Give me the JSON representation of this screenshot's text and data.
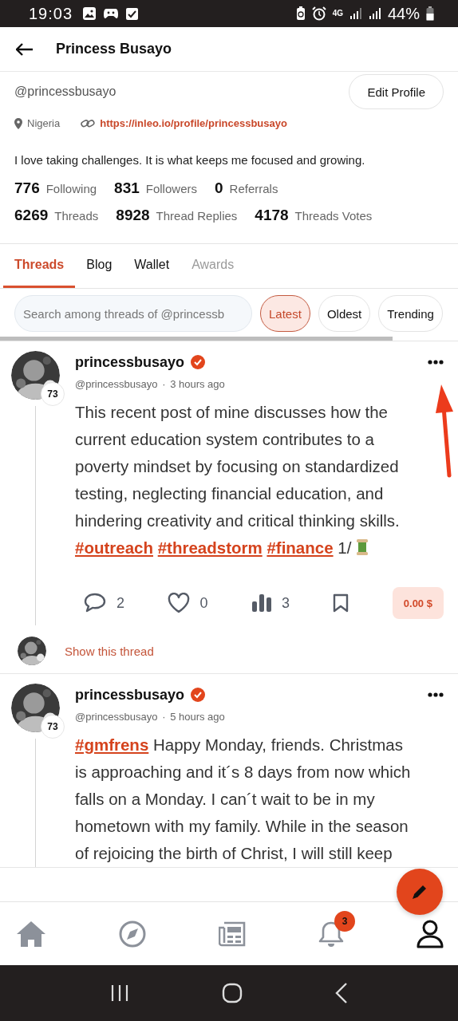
{
  "status_bar": {
    "time": "19:03",
    "network": "4G",
    "battery": "44%"
  },
  "header": {
    "title": "Princess Busayo"
  },
  "profile": {
    "handle": "@princessbusayo",
    "edit_button": "Edit Profile",
    "location": "Nigeria",
    "link": "https://inleo.io/profile/princessbusayo",
    "bio": "I love taking challenges. It is what keeps me focused and growing.",
    "stat_rows": [
      {
        "items": [
          {
            "count": "776",
            "label": "Following"
          },
          {
            "count": "831",
            "label": "Followers"
          },
          {
            "count": "0",
            "label": "Referrals"
          }
        ]
      },
      {
        "items": [
          {
            "count": "6269",
            "label": "Threads"
          },
          {
            "count": "8928",
            "label": "Thread Replies"
          },
          {
            "count": "4178",
            "label": "Threads Votes"
          }
        ]
      }
    ]
  },
  "tabs": [
    {
      "label": "Threads",
      "selected": true,
      "disabled": false
    },
    {
      "label": "Blog",
      "selected": false,
      "disabled": false
    },
    {
      "label": "Wallet",
      "selected": false,
      "disabled": false
    },
    {
      "label": "Awards",
      "selected": false,
      "disabled": true
    }
  ],
  "search": {
    "placeholder": "Search among threads of @princessb"
  },
  "sort_options": [
    {
      "label": "Latest",
      "selected": true
    },
    {
      "label": "Oldest",
      "selected": false
    },
    {
      "label": "Trending",
      "selected": false
    }
  ],
  "posts": [
    {
      "author": "princessbusayo",
      "verified": true,
      "reputation": "73",
      "handle": "@princessbusayo",
      "separator": "·",
      "time": "3 hours ago",
      "body": [
        {
          "kind": "text",
          "text": "This recent post of mine discusses how the current education system contributes to a poverty mindset by focusing on standardized testing, neglecting financial education, and hindering creativity and critical thinking skills."
        },
        {
          "kind": "tag",
          "text": "#outreach"
        },
        {
          "kind": "tag",
          "text": "#threadstorm"
        },
        {
          "kind": "tag",
          "text": "#finance"
        },
        {
          "kind": "text",
          "text": "1/"
        },
        {
          "kind": "spool"
        }
      ],
      "actions": {
        "comments": "2",
        "likes": "0",
        "votes": "3",
        "payout": "0.00 $"
      },
      "show_thread": "Show this thread"
    },
    {
      "author": "princessbusayo",
      "verified": true,
      "reputation": "73",
      "handle": "@princessbusayo",
      "separator": "·",
      "time": "5 hours ago",
      "body": [
        {
          "kind": "tag",
          "text": "#gmfrens"
        },
        {
          "kind": "text",
          "text": "Happy Monday, friends. Christmas is approaching and it´s 8 days from now which falls on a Monday. I can´t wait to be in my hometown with my family. While in the season of rejoicing the birth of Christ, I will still keep"
        }
      ]
    }
  ],
  "bottom_nav": [
    {
      "kind": "home",
      "selected": false
    },
    {
      "kind": "explore",
      "selected": false
    },
    {
      "kind": "news",
      "selected": false
    },
    {
      "kind": "notifications",
      "selected": false,
      "badge": "3"
    },
    {
      "kind": "profile",
      "selected": true
    }
  ]
}
